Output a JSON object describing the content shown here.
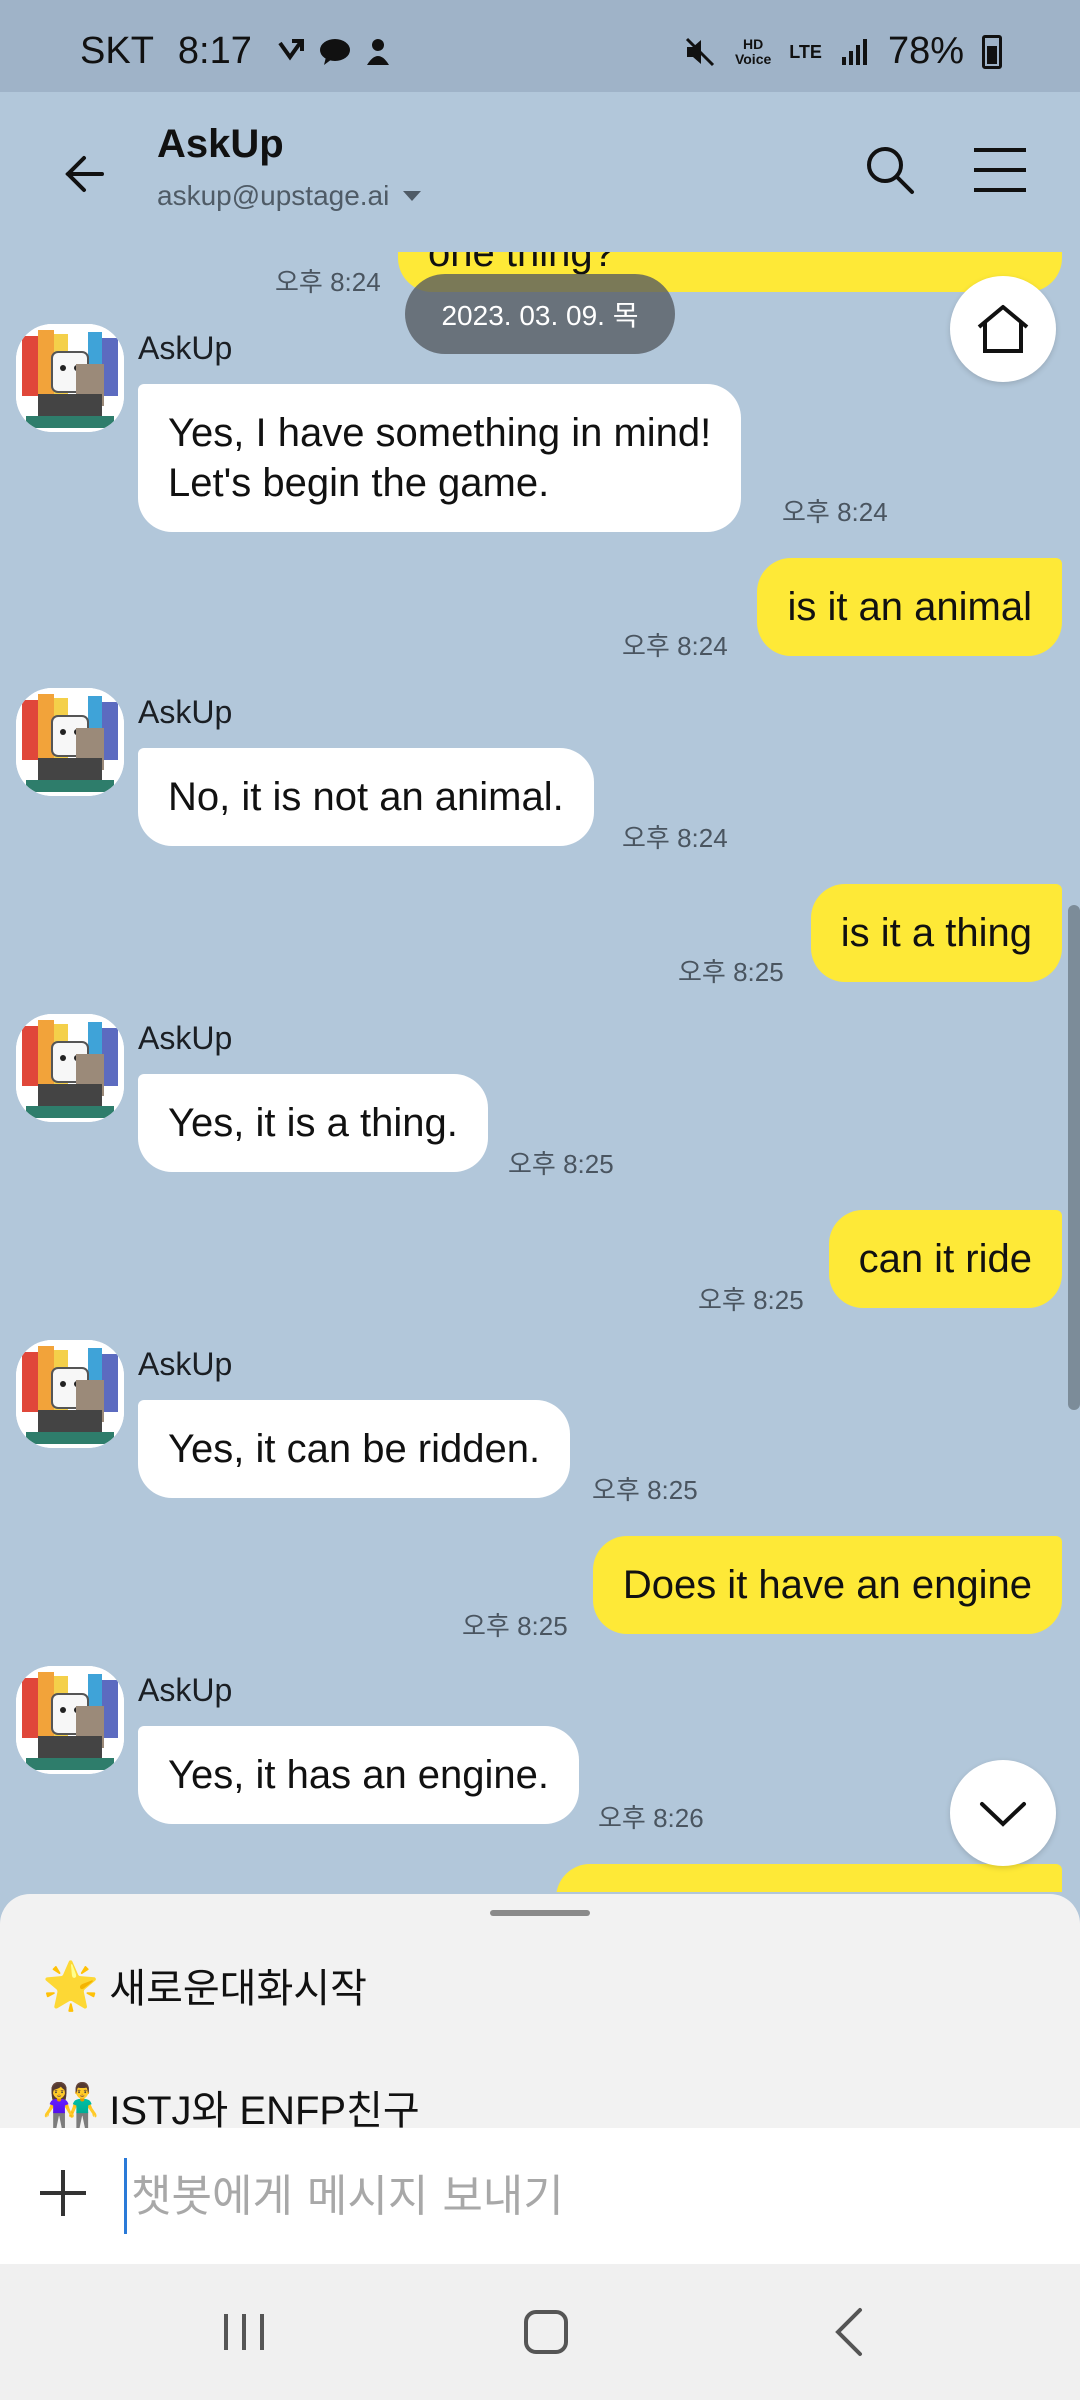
{
  "status_bar": {
    "carrier": "SKT",
    "time": "8:17",
    "hd_voice": "HD\nVoice",
    "network": "LTE",
    "battery": "78%"
  },
  "header": {
    "title": "AskUp",
    "subtitle": "askup@upstage.ai"
  },
  "date_divider": "2023. 03. 09. 목",
  "messages": [
    {
      "dir": "out",
      "text": "one thing?",
      "time": "오후 8:24"
    },
    {
      "dir": "in",
      "sender": "AskUp",
      "text": "Yes, I have something in mind!\nLet's begin the game.",
      "time": "오후 8:24"
    },
    {
      "dir": "out",
      "text": "is it an animal",
      "time": "오후 8:24"
    },
    {
      "dir": "in",
      "sender": "AskUp",
      "text": "No, it is not an animal.",
      "time": "오후 8:24"
    },
    {
      "dir": "out",
      "text": "is it a thing",
      "time": "오후 8:25"
    },
    {
      "dir": "in",
      "sender": "AskUp",
      "text": "Yes, it is a thing.",
      "time": "오후 8:25"
    },
    {
      "dir": "out",
      "text": "can it ride",
      "time": "오후 8:25"
    },
    {
      "dir": "in",
      "sender": "AskUp",
      "text": "Yes, it can be ridden.",
      "time": "오후 8:25"
    },
    {
      "dir": "out",
      "text": "Does it have an engine",
      "time": "오후 8:25"
    },
    {
      "dir": "in",
      "sender": "AskUp",
      "text": "Yes, it has an engine.",
      "time": "오후 8:26"
    }
  ],
  "quick_menu": [
    {
      "icon": "sparkle-star-icon",
      "glyph": "🌟",
      "label": "새로운대화시작"
    },
    {
      "icon": "couple-icon",
      "glyph": "👫",
      "label": "ISTJ와 ENFP친구"
    }
  ],
  "input": {
    "placeholder": "챗봇에게 메시지 보내기"
  },
  "colors": {
    "chat_bg": "#b2c7da",
    "status_bg": "#9fb3c8",
    "out_bubble": "#fee937",
    "in_bubble": "#ffffff"
  }
}
